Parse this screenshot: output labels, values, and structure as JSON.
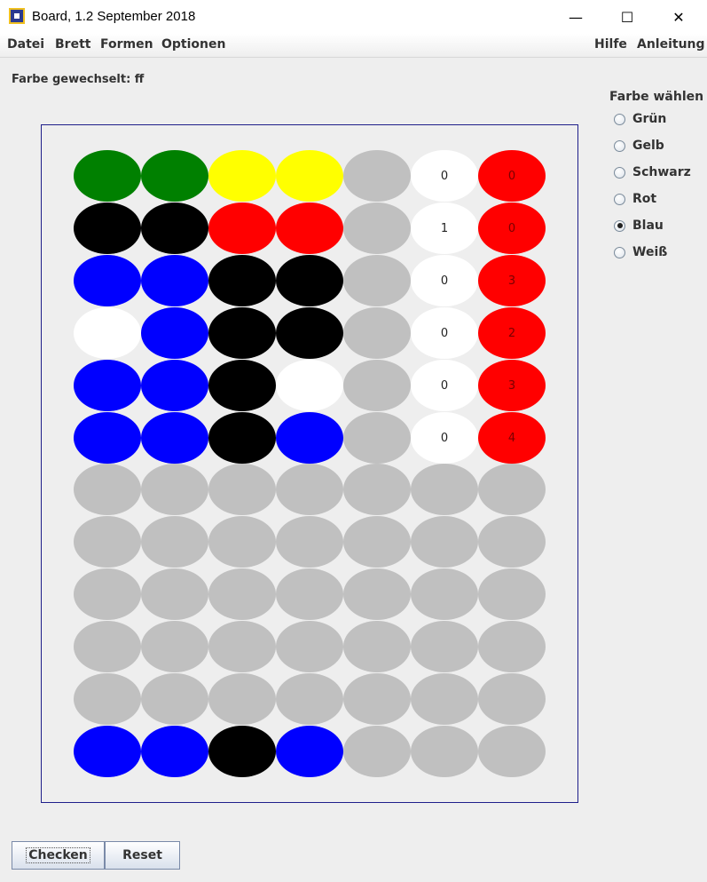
{
  "window": {
    "title": "Board, 1.2 September 2018",
    "minimize_glyph": "—",
    "maximize_glyph": "☐",
    "close_glyph": "✕"
  },
  "menu": {
    "left": [
      "Datei",
      "Brett",
      "Formen",
      "Optionen"
    ],
    "right": [
      "Hilfe",
      "Anleitung"
    ]
  },
  "status": "Farbe gewechselt: ff",
  "colors": {
    "G": "#008000",
    "Y": "#ffff00",
    "K": "#000000",
    "R": "#ff0000",
    "B": "#0000ff",
    "W": "#ffffff",
    "E": "#c0c0c0"
  },
  "board": {
    "rows": [
      {
        "pegs": [
          "G",
          "G",
          "Y",
          "Y",
          "E"
        ],
        "hint_white": "0",
        "hint_red": "0"
      },
      {
        "pegs": [
          "K",
          "K",
          "R",
          "R",
          "E"
        ],
        "hint_white": "1",
        "hint_red": "0"
      },
      {
        "pegs": [
          "B",
          "B",
          "K",
          "K",
          "E"
        ],
        "hint_white": "0",
        "hint_red": "3"
      },
      {
        "pegs": [
          "W",
          "B",
          "K",
          "K",
          "E"
        ],
        "hint_white": "0",
        "hint_red": "2"
      },
      {
        "pegs": [
          "B",
          "B",
          "K",
          "W",
          "E"
        ],
        "hint_white": "0",
        "hint_red": "3"
      },
      {
        "pegs": [
          "B",
          "B",
          "K",
          "B",
          "E"
        ],
        "hint_white": "0",
        "hint_red": "4"
      },
      {
        "pegs": [
          "E",
          "E",
          "E",
          "E",
          "E"
        ],
        "hint_white": "",
        "hint_red": ""
      },
      {
        "pegs": [
          "E",
          "E",
          "E",
          "E",
          "E"
        ],
        "hint_white": "",
        "hint_red": ""
      },
      {
        "pegs": [
          "E",
          "E",
          "E",
          "E",
          "E"
        ],
        "hint_white": "",
        "hint_red": ""
      },
      {
        "pegs": [
          "E",
          "E",
          "E",
          "E",
          "E"
        ],
        "hint_white": "",
        "hint_red": ""
      },
      {
        "pegs": [
          "E",
          "E",
          "E",
          "E",
          "E"
        ],
        "hint_white": "",
        "hint_red": ""
      },
      {
        "pegs": [
          "B",
          "B",
          "K",
          "B",
          "E"
        ],
        "hint_white": "",
        "hint_red": ""
      }
    ]
  },
  "color_picker": {
    "title": "Farbe wählen",
    "options": [
      "Grün",
      "Gelb",
      "Schwarz",
      "Rot",
      "Blau",
      "Weiß"
    ],
    "selected": "Blau"
  },
  "buttons": {
    "check": "Checken",
    "reset": "Reset"
  }
}
